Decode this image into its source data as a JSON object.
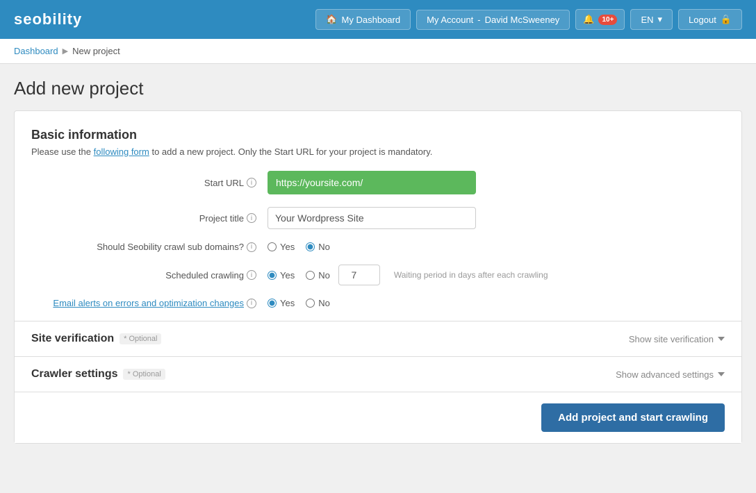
{
  "header": {
    "logo": "seobility",
    "nav": {
      "dashboard_label": "My Dashboard",
      "account_label": "My Account",
      "account_user": "David McSweeney",
      "notifications_count": "10+",
      "language_label": "EN",
      "logout_label": "Logout"
    }
  },
  "breadcrumb": {
    "home": "Dashboard",
    "current": "New project"
  },
  "page": {
    "title": "Add new project"
  },
  "form": {
    "section_title": "Basic information",
    "section_desc_prefix": "Please use the ",
    "section_desc_link": "following form",
    "section_desc_suffix": " to add a new project. Only the Start URL for your project is mandatory.",
    "start_url_label": "Start URL",
    "start_url_placeholder": "https://yoursite.com/",
    "start_url_value": "https://yoursite.com/",
    "project_title_label": "Project title",
    "project_title_placeholder": "Your Wordpress Site",
    "project_title_value": "Your Wordpress Site",
    "subdomain_label": "Should Seobility crawl sub domains?",
    "subdomain_yes": "Yes",
    "subdomain_no": "No",
    "subdomain_default": "no",
    "scheduled_label": "Scheduled crawling",
    "scheduled_yes": "Yes",
    "scheduled_no": "No",
    "scheduled_default": "yes",
    "scheduled_days_value": "7",
    "scheduled_days_hint": "Waiting period in days after each crawling",
    "email_alerts_label": "Email alerts on errors and optimization changes",
    "email_alerts_yes": "Yes",
    "email_alerts_no": "No",
    "email_alerts_default": "yes"
  },
  "site_verification": {
    "title": "Site verification",
    "optional": "* Optional",
    "toggle_label": "Show site verification"
  },
  "crawler_settings": {
    "title": "Crawler settings",
    "optional": "* Optional",
    "toggle_label": "Show advanced settings"
  },
  "footer": {
    "submit_label": "Add project and start crawling"
  }
}
